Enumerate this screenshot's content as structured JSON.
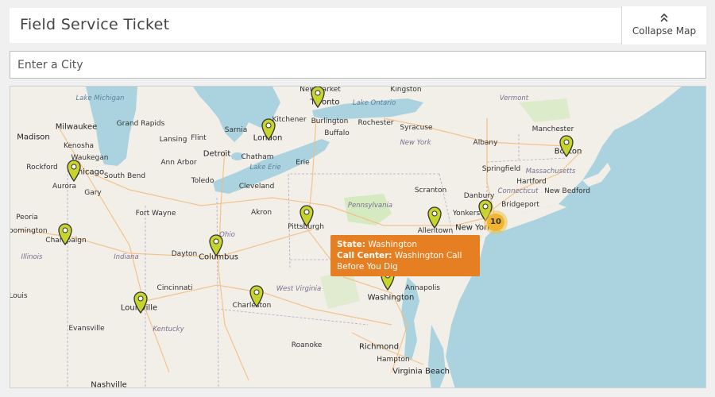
{
  "header": {
    "title": "Field Service Ticket",
    "collapse_label": "Collapse Map"
  },
  "search": {
    "placeholder": "Enter a City",
    "value": ""
  },
  "map": {
    "cities": [
      "Newmarket",
      "Kingston",
      "Toronto",
      "Lake Ontario",
      "Lake Michigan",
      "Vermont",
      "Kitchener",
      "Burlington",
      "Rochester",
      "Syracuse",
      "Milwaukee",
      "Grand Rapids",
      "Sarnia",
      "London",
      "Buffalo",
      "Manchester",
      "Madison",
      "Kenosha",
      "Lansing",
      "Flint",
      "New York",
      "Albany",
      "Boston",
      "Waukegan",
      "Detroit",
      "Chatham",
      "Springfield",
      "Massachusetts",
      "Rockford",
      "Chicago",
      "Ann Arbor",
      "Lake Erie",
      "Erie",
      "Hartford",
      "South Bend",
      "Toledo",
      "Connecticut",
      "Aurora",
      "Gary",
      "Cleveland",
      "Scranton",
      "Danbury",
      "New Bedford",
      "Pennsylvania",
      "Yonkers",
      "Bridgeport",
      "Fort Wayne",
      "Akron",
      "Peoria",
      "Pittsburgh",
      "Allentown",
      "New York",
      "Bloomington",
      "Champaign",
      "Ohio",
      "Dayton",
      "Columbus",
      "Illinois",
      "Indiana",
      "Cincinnati",
      "West Virginia",
      "Annapolis",
      "Washington",
      "Louisville",
      "Louis",
      "Charleston",
      "Evansville",
      "Kentucky",
      "Roanoke",
      "Richmond",
      "Hampton",
      "Virginia Beach",
      "Nashville"
    ],
    "cluster_count": "10"
  },
  "popup": {
    "state_label": "State:",
    "state_value": "Washington",
    "center_label": "Call Center:",
    "center_value": "Washington Call Before You Dig"
  },
  "colors": {
    "pin": "#c8d42e",
    "cluster": "#f0b42f",
    "popup": "#e67e22",
    "water": "#aad3df"
  },
  "icons": {
    "collapse": "double-chevron-up-icon",
    "marker": "map-pin-icon"
  }
}
